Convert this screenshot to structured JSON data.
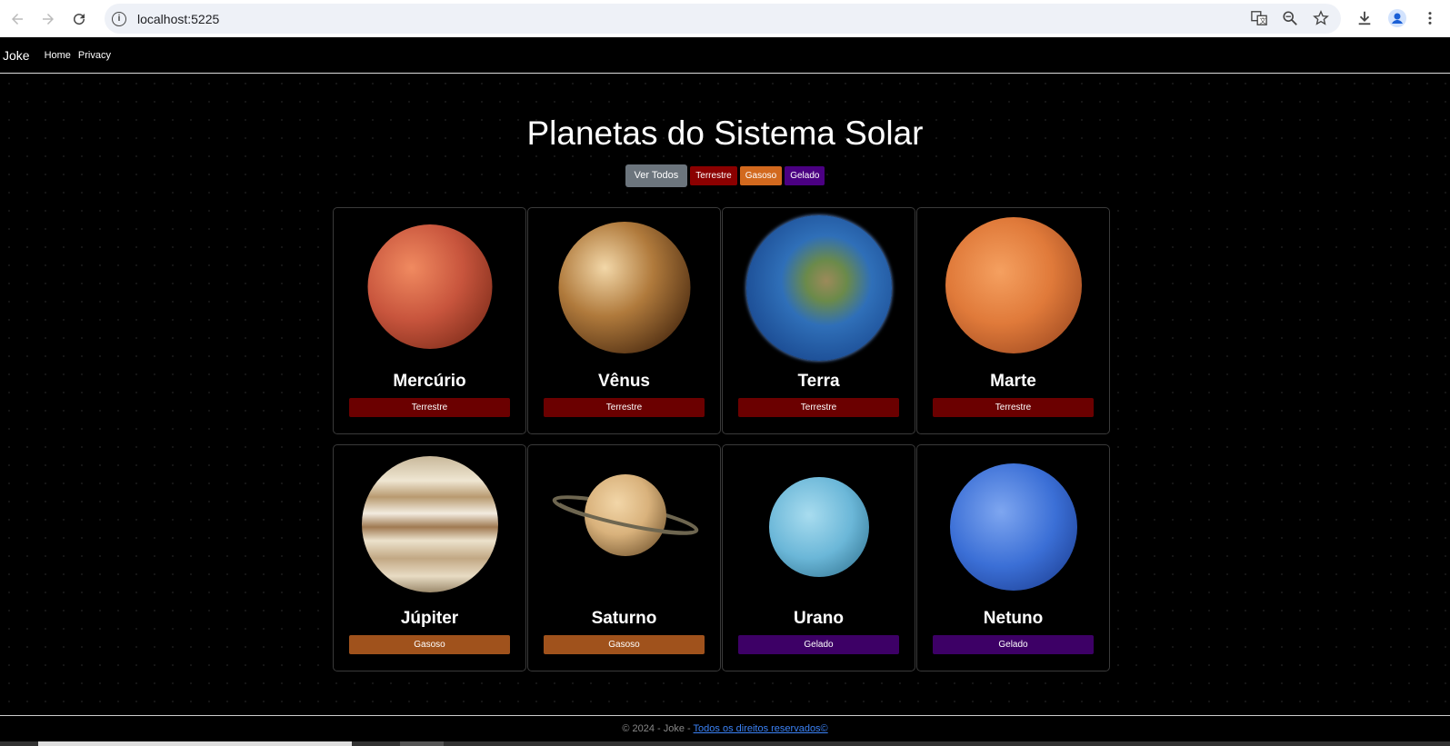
{
  "browser": {
    "url": "localhost:5225"
  },
  "navbar": {
    "brand": "Joke",
    "links": [
      "Home",
      "Privacy"
    ]
  },
  "page": {
    "title": "Planetas do Sistema Solar",
    "filters": [
      "Ver Todos",
      "Terrestre",
      "Gasoso",
      "Gelado"
    ]
  },
  "planets": [
    {
      "name": "Mercúrio",
      "type": "Terrestre",
      "color": "#c8553d"
    },
    {
      "name": "Vênus",
      "type": "Terrestre",
      "color": "#b07a3c"
    },
    {
      "name": "Terra",
      "type": "Terrestre",
      "color": "#2f6fb8"
    },
    {
      "name": "Marte",
      "type": "Terrestre",
      "color": "#e07a3a"
    },
    {
      "name": "Júpiter",
      "type": "Gasoso",
      "color": "#d8c3a0"
    },
    {
      "name": "Saturno",
      "type": "Gasoso",
      "color": "#d9b27c"
    },
    {
      "name": "Urano",
      "type": "Gelado",
      "color": "#6bb7d8"
    },
    {
      "name": "Netuno",
      "type": "Gelado",
      "color": "#3b6fd6"
    }
  ],
  "footer": {
    "text": "© 2024 - Joke - ",
    "link": "Todos os direitos reservados©"
  }
}
